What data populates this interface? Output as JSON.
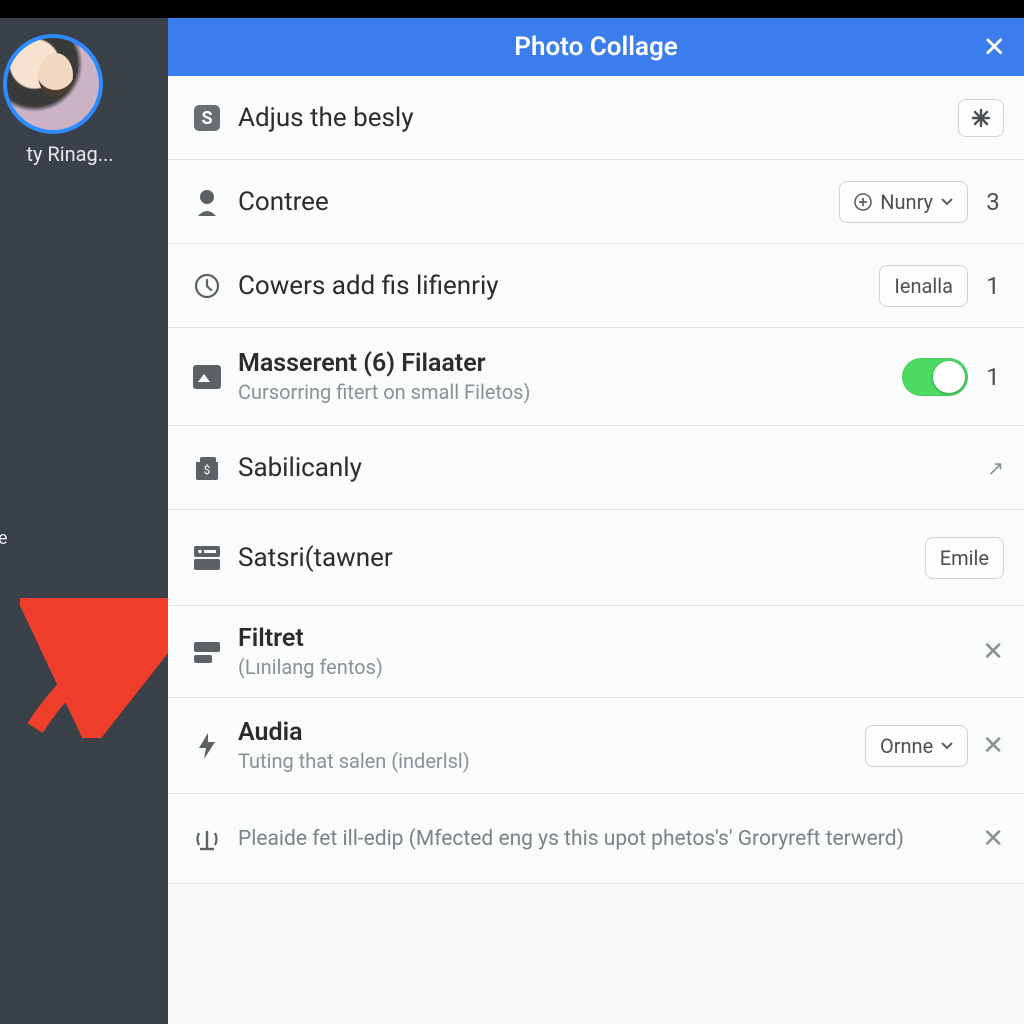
{
  "header": {
    "title": "Photo Collage"
  },
  "sidebar": {
    "name": "ty Rinag...",
    "letter": "e"
  },
  "rows": {
    "r1": {
      "label": "Adjus the besly"
    },
    "r2": {
      "label": "Contree",
      "btn": "Nunry",
      "num": "3"
    },
    "r3": {
      "label": "Cowers add fis lifienriy",
      "btn": "Ienalla",
      "num": "1"
    },
    "r4": {
      "label": "Masserent (6) Filaater",
      "sub": "Cursorring fitert on small Filetos)",
      "num": "1"
    },
    "r5": {
      "label": "Sabilicanly"
    },
    "r6": {
      "label": "Satsri(tawner",
      "btn": "Emile"
    },
    "r7": {
      "label": "Filtret",
      "sub": "(Lınilang fentos)"
    },
    "r8": {
      "label": "Audia",
      "sub": "Tuting that salen (inderlsl)",
      "btn": "Ornne"
    },
    "r9": {
      "label": "Pleaide fet ill-edip (Mfected eng ys this upot phetos's' Groryreft terwerd)"
    }
  }
}
